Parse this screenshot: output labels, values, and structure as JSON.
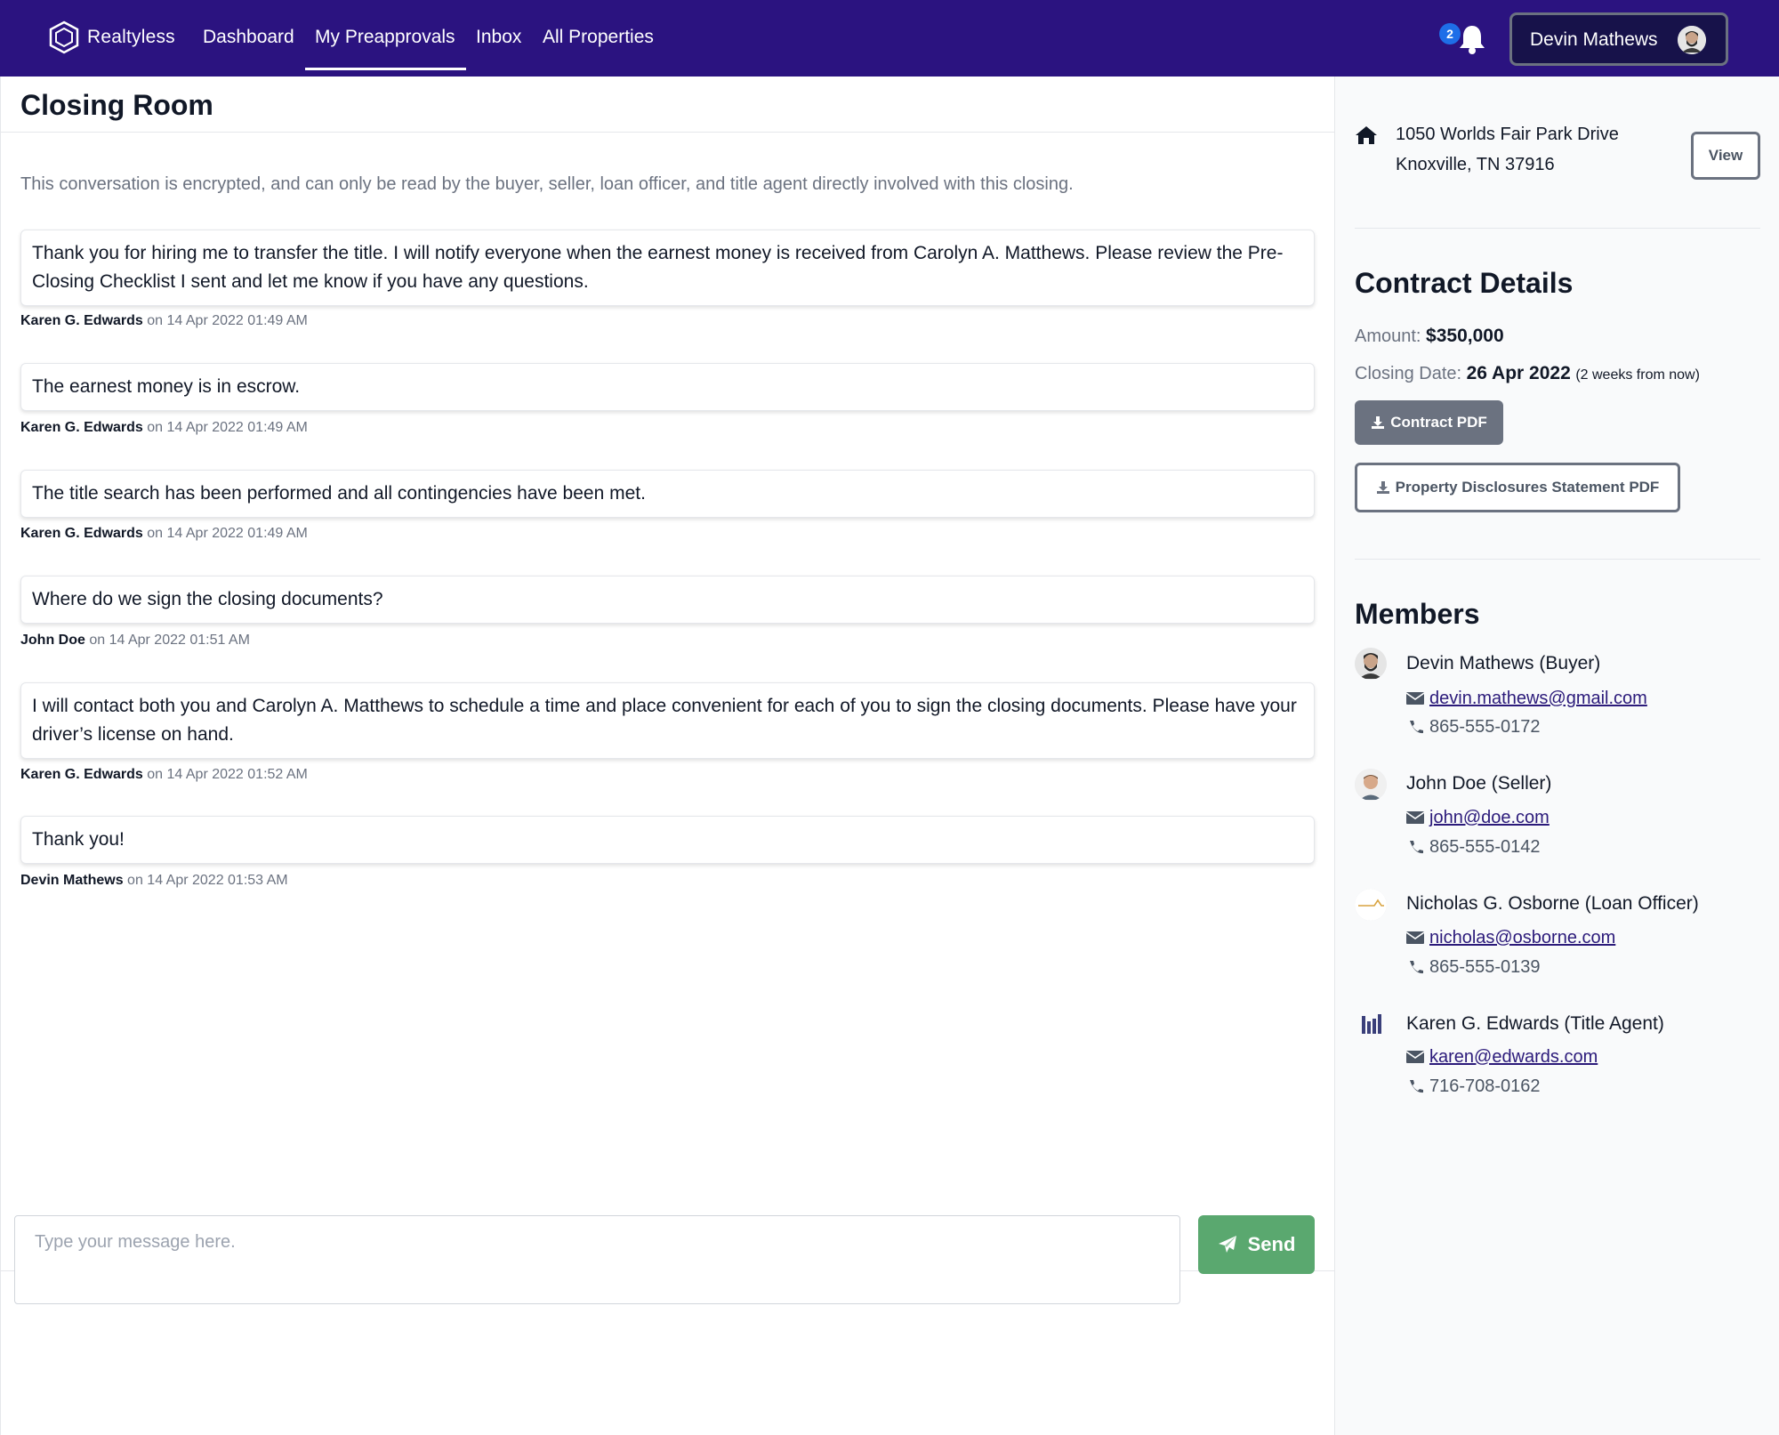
{
  "nav": {
    "brand": "Realtyless",
    "links": [
      "Dashboard",
      "My Preapprovals",
      "Inbox",
      "All Properties"
    ],
    "active_link": "My Preapprovals",
    "notification_count": "2",
    "user_name": "Devin Mathews"
  },
  "main": {
    "title": "Closing Room",
    "encryption_note": "This conversation is encrypted, and can only be read by the buyer, seller, loan officer, and title agent directly involved with this closing.",
    "messages": [
      {
        "text": "Thank you for hiring me to transfer the title. I will notify everyone when the earnest money is received from Carolyn A. Matthews. Please review the Pre-Closing Checklist I sent and let me know if you have any questions.",
        "author": "Karen G. Edwards",
        "timestamp": "on 14 Apr 2022 01:49 AM"
      },
      {
        "text": "The earnest money is in escrow.",
        "author": "Karen G. Edwards",
        "timestamp": "on 14 Apr 2022 01:49 AM"
      },
      {
        "text": "The title search has been performed and all contingencies have been met.",
        "author": "Karen G. Edwards",
        "timestamp": "on 14 Apr 2022 01:49 AM"
      },
      {
        "text": "Where do we sign the closing documents?",
        "author": "John Doe",
        "timestamp": "on 14 Apr 2022 01:51 AM"
      },
      {
        "text": "I will contact both you and Carolyn A. Matthews to schedule a time and place convenient for each of you to sign the closing documents. Please have your driver’s license on hand.",
        "author": "Karen G. Edwards",
        "timestamp": "on 14 Apr 2022 01:52 AM"
      },
      {
        "text": "Thank you!",
        "author": "Devin Mathews",
        "timestamp": "on 14 Apr 2022 01:53 AM"
      }
    ],
    "compose": {
      "placeholder": "Type your message here.",
      "value": "",
      "send_label": "Send"
    }
  },
  "sidebar": {
    "address_line1": "1050 Worlds Fair Park Drive",
    "address_line2": "Knoxville, TN 37916",
    "view_label": "View",
    "contract": {
      "heading": "Contract Details",
      "amount_label": "Amount:",
      "amount_value": "$350,000",
      "closing_label": "Closing Date:",
      "closing_value": "26 Apr 2022",
      "closing_note": "(2 weeks from now)",
      "contract_pdf_label": "Contract PDF",
      "disclosures_pdf_label": "Property Disclosures Statement PDF"
    },
    "members": {
      "heading": "Members",
      "list": [
        {
          "name": "Devin Mathews (Buyer)",
          "email": "devin.mathews@gmail.com",
          "phone": "865-555-0172",
          "avatar_icon": "person-photo-bearded"
        },
        {
          "name": "John Doe (Seller)",
          "email": "john@doe.com",
          "phone": "865-555-0142",
          "avatar_icon": "person-photo"
        },
        {
          "name": "Nicholas G. Osborne (Loan Officer)",
          "email": "nicholas@osborne.com",
          "phone": "865-555-0139",
          "avatar_icon": "company-logo-gold"
        },
        {
          "name": "Karen G. Edwards (Title Agent)",
          "email": "karen@edwards.com",
          "phone": "716-708-0162",
          "avatar_icon": "company-logo-columns"
        }
      ]
    }
  },
  "colors": {
    "navbar": "#2b1380",
    "send_button": "#5aa86f",
    "secondary_button": "#6b7280",
    "link": "#2b1a7a",
    "badge": "#1e6ee8"
  }
}
